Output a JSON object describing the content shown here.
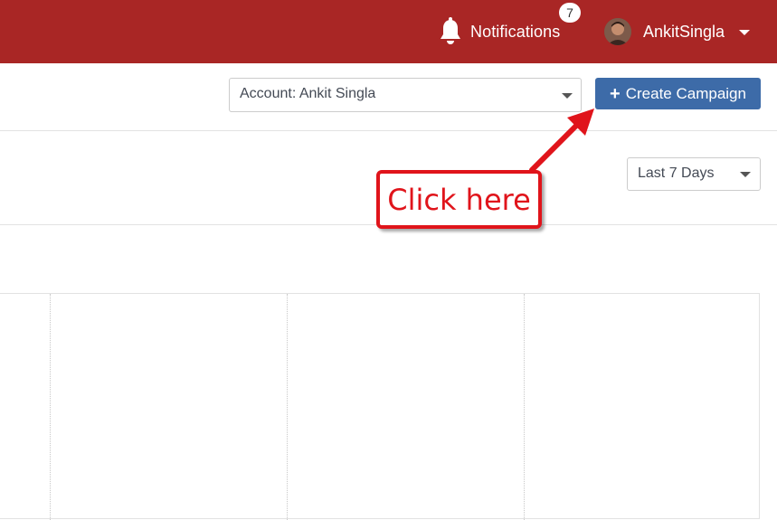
{
  "header": {
    "notifications_label": "Notifications",
    "notifications_count": "7",
    "user_name": "AnkitSingla"
  },
  "toolbar": {
    "account_select_value": "Account: Ankit Singla",
    "create_campaign_label": "Create Campaign"
  },
  "filters": {
    "date_range_value": "Last 7 Days"
  },
  "annotation": {
    "callout_text": "Click here"
  },
  "colors": {
    "header_bg": "#a92625",
    "primary_button": "#3d6ba8",
    "annotation_red": "#e0141b"
  },
  "icons": {
    "notifications": "bell-icon",
    "user_menu": "chevron-down-icon",
    "create": "plus-icon"
  }
}
